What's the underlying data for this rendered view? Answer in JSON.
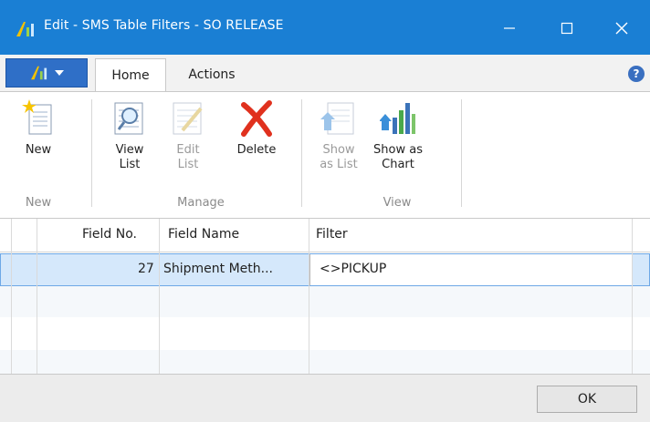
{
  "window": {
    "title": "Edit - SMS Table Filters - SO RELEASE",
    "minimize_icon": "minimize-icon",
    "maximize_icon": "maximize-icon",
    "close_icon": "close-icon",
    "accent_color": "#1a7fd4"
  },
  "ribbon_tabs": {
    "home": "Home",
    "actions": "Actions",
    "help": "?"
  },
  "ribbon": {
    "groups": {
      "new": "New",
      "manage": "Manage",
      "view": "View"
    },
    "buttons": {
      "new": [
        "New"
      ],
      "view_list": [
        "View",
        "List"
      ],
      "edit_list": [
        "Edit",
        "List"
      ],
      "delete": [
        "Delete"
      ],
      "show_as_list": [
        "Show",
        "as List"
      ],
      "show_as_chart": [
        "Show as",
        "Chart"
      ]
    }
  },
  "grid": {
    "columns": [
      "Field No.",
      "Field Name",
      "Filter"
    ],
    "rows": [
      {
        "field_no": "27",
        "field_name": "Shipment Meth...",
        "filter": "<>PICKUP"
      }
    ]
  },
  "footer": {
    "ok": "OK"
  }
}
